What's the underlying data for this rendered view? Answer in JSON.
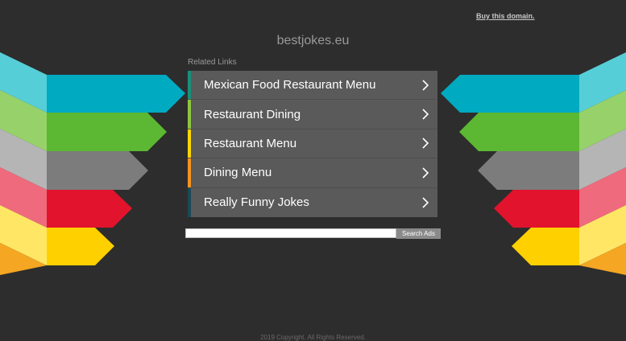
{
  "header": {
    "buy_link": "Buy this domain.",
    "domain": "bestjokes.eu"
  },
  "related": {
    "heading": "Related Links",
    "links": [
      {
        "label": "Mexican Food Restaurant Menu",
        "accent": "#1a8f7a"
      },
      {
        "label": "Restaurant Dining",
        "accent": "#8dc63f"
      },
      {
        "label": "Restaurant Menu",
        "accent": "#ffd600"
      },
      {
        "label": "Dining Menu",
        "accent": "#f7931e"
      },
      {
        "label": "Really Funny Jokes",
        "accent": "#1a4a55"
      }
    ]
  },
  "search": {
    "button": "Search Ads",
    "value": ""
  },
  "footer": {
    "copyright": "2019 Copyright. All Rights Reserved."
  },
  "colors": {
    "background": "#2d2d2d",
    "panel": "#5a5a5a",
    "stripes": [
      "#00a8c0",
      "#5cb832",
      "#7b7b7b",
      "#e2132d",
      "#ffd000"
    ]
  }
}
